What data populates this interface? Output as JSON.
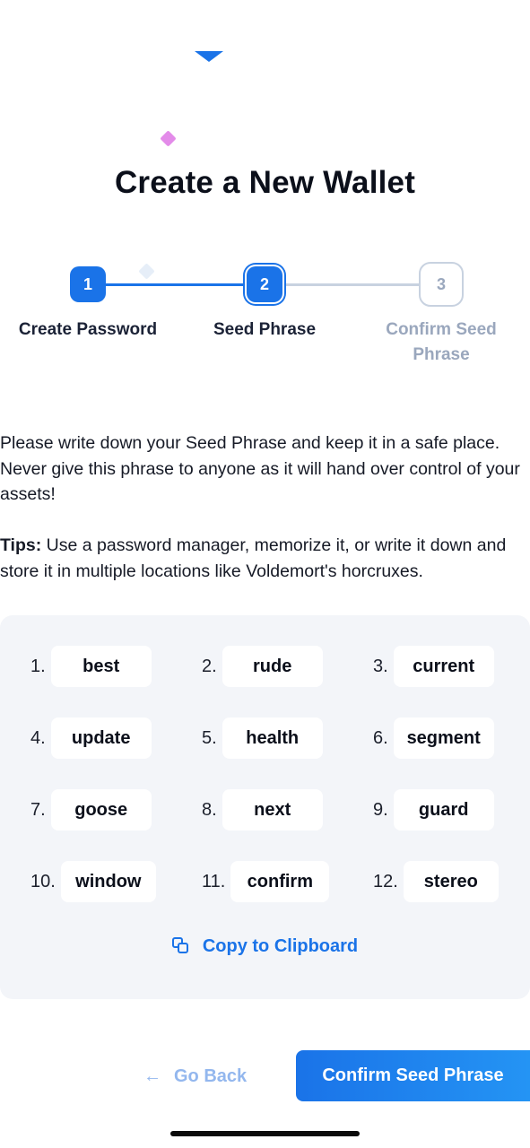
{
  "header": {
    "title": "Create a New Wallet"
  },
  "stepper": {
    "steps": [
      {
        "number": "1",
        "label": "Create Password",
        "state": "complete"
      },
      {
        "number": "2",
        "label": "Seed Phrase",
        "state": "active"
      },
      {
        "number": "3",
        "label": "Confirm Seed Phrase",
        "state": "upcoming"
      }
    ]
  },
  "instructions": {
    "text": "Please write down your Seed Phrase and keep it in a safe place. Never give this phrase to anyone as it will hand over control of your assets!",
    "tips_label": "Tips:",
    "tips_text": " Use a password manager, memorize it, or write it down and store it in multiple locations like Voldemort's horcruxes."
  },
  "seed": {
    "words": [
      {
        "index": "1.",
        "word": "best"
      },
      {
        "index": "2.",
        "word": "rude"
      },
      {
        "index": "3.",
        "word": "current"
      },
      {
        "index": "4.",
        "word": "update"
      },
      {
        "index": "5.",
        "word": "health"
      },
      {
        "index": "6.",
        "word": "segment"
      },
      {
        "index": "7.",
        "word": "goose"
      },
      {
        "index": "8.",
        "word": "next"
      },
      {
        "index": "9.",
        "word": "guard"
      },
      {
        "index": "10.",
        "word": "window"
      },
      {
        "index": "11.",
        "word": "confirm"
      },
      {
        "index": "12.",
        "word": "stereo"
      }
    ],
    "copy_label": "Copy to Clipboard"
  },
  "actions": {
    "back_label": "Go Back",
    "back_icon": "arrow-left-icon",
    "confirm_label": "Confirm Seed Phrase"
  },
  "colors": {
    "primary": "#1a73e8",
    "muted": "#9aa7bd",
    "panel_bg": "#f3f5f9",
    "back_text": "#93b7ee",
    "accent_pink": "#e38be9"
  }
}
